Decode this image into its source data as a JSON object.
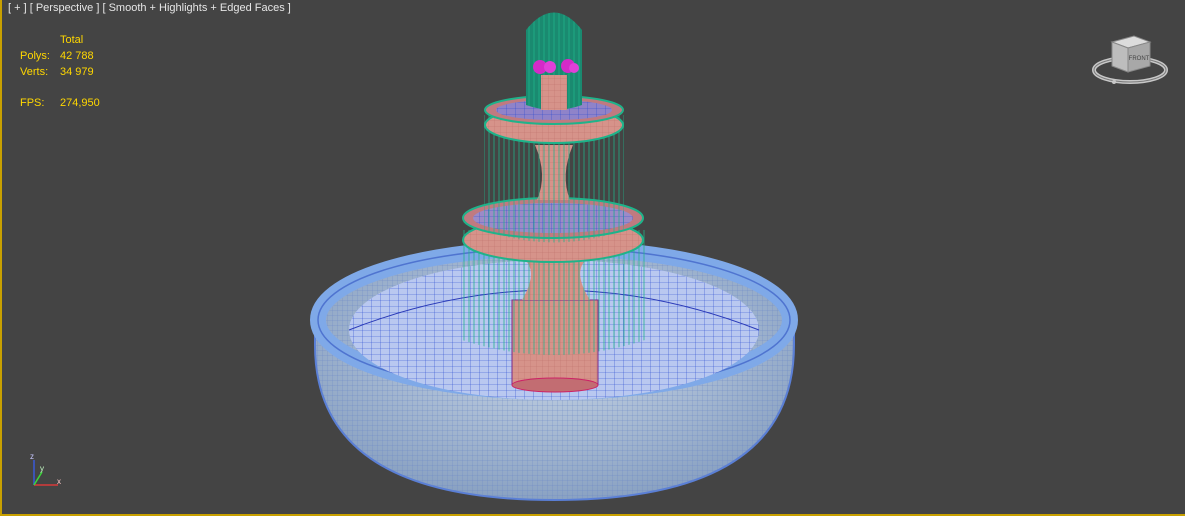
{
  "viewport": {
    "label_plus": "[ + ]",
    "label_view": "[ Perspective ]",
    "label_shading": "[ Smooth + Highlights + Edged Faces ]"
  },
  "stats": {
    "header": "Total",
    "polys_label": "Polys:",
    "polys_value": "42 788",
    "verts_label": "Verts:",
    "verts_value": "34 979",
    "fps_label": "FPS:",
    "fps_value": "274,950"
  },
  "viewcube": {
    "face_label": "FRONT"
  },
  "axis_tripod": {
    "x": "x",
    "y": "y",
    "z": "z"
  },
  "colors": {
    "background": "#444444",
    "stats_text": "#ffd700",
    "viewport_border": "#c8a000",
    "water_wire": "#20b08a",
    "stone_pink": "#d4948c",
    "basin_blue": "#7fa9e8",
    "wire_dark": "#2020c0"
  }
}
